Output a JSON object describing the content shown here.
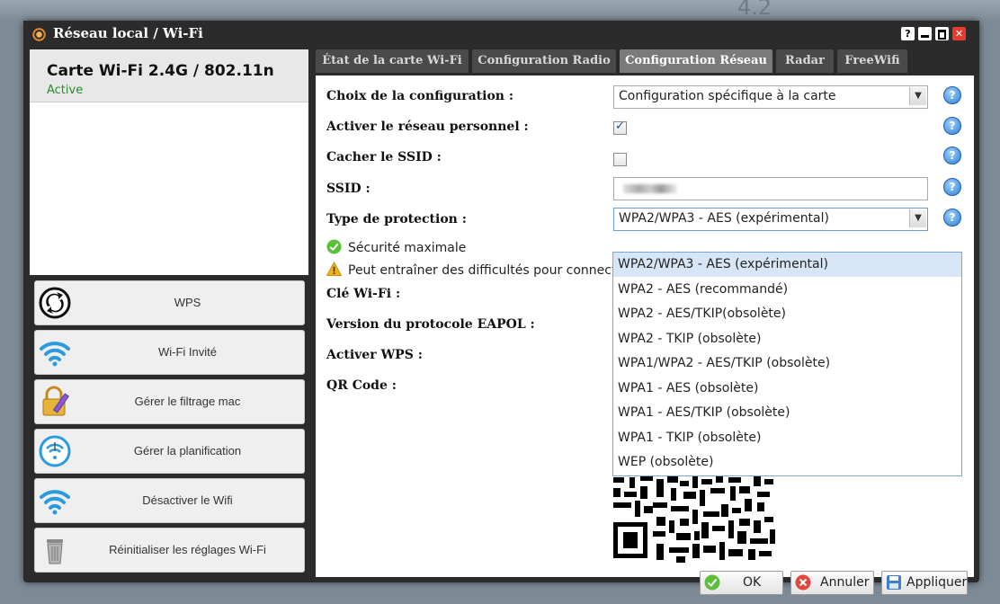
{
  "window": {
    "title": "Réseau local / Wi-Fi",
    "controls": [
      "?",
      "_",
      "□",
      "✕"
    ],
    "bg_version": "4.2"
  },
  "card": {
    "title": "Carte Wi-Fi 2.4G / 802.11n",
    "status": "Active"
  },
  "sidebar": {
    "buttons": [
      {
        "label": "WPS",
        "icon": "wps-icon"
      },
      {
        "label": "Wi-Fi Invité",
        "icon": "wifi-icon"
      },
      {
        "label": "Gérer le filtrage mac",
        "icon": "lock-pencil-icon"
      },
      {
        "label": "Gérer la planification",
        "icon": "wifi-clock-icon"
      },
      {
        "label": "Désactiver le Wifi",
        "icon": "wifi-icon"
      },
      {
        "label": "Réinitialiser les réglages Wi-Fi",
        "icon": "trash-icon"
      }
    ]
  },
  "tabs": [
    {
      "label": "État de la carte Wi-Fi"
    },
    {
      "label": "Configuration Radio"
    },
    {
      "label": "Configuration Réseau"
    },
    {
      "label": "Radar"
    },
    {
      "label": "FreeWifi"
    }
  ],
  "form": {
    "config_label": "Choix de la configuration :",
    "config_value": "Configuration spécifique à la carte",
    "personal_label": "Activer le réseau personnel :",
    "personal_checked": true,
    "hide_ssid_label": "Cacher le SSID :",
    "hide_ssid_checked": false,
    "ssid_label": "SSID :",
    "protection_label": "Type de protection :",
    "protection_value": "WPA2/WPA3 - AES (expérimental)",
    "security_ok": "Sécurité maximale",
    "security_warn": "Peut entraîner des difficultés pour connecter",
    "key_label": "Clé Wi-Fi :",
    "eapol_label": "Version du protocole EAPOL :",
    "wps_label": "Activer WPS :",
    "qr_label": "QR Code :"
  },
  "dropdown_options": [
    "WPA2/WPA3 - AES (expérimental)",
    "WPA2 - AES (recommandé)",
    "WPA2 - AES/TKIP(obsolète)",
    "WPA2 - TKIP (obsolète)",
    "WPA1/WPA2 - AES/TKIP (obsolète)",
    "WPA1 - AES (obsolète)",
    "WPA1 - AES/TKIP (obsolète)",
    "WPA1 - TKIP (obsolète)",
    "WEP (obsolète)"
  ],
  "buttons": {
    "ok": "OK",
    "cancel": "Annuler",
    "apply": "Appliquer"
  },
  "colors": {
    "accent": "#2f7fd6",
    "active_status": "#2a8a2a",
    "close": "#e53b2c"
  }
}
